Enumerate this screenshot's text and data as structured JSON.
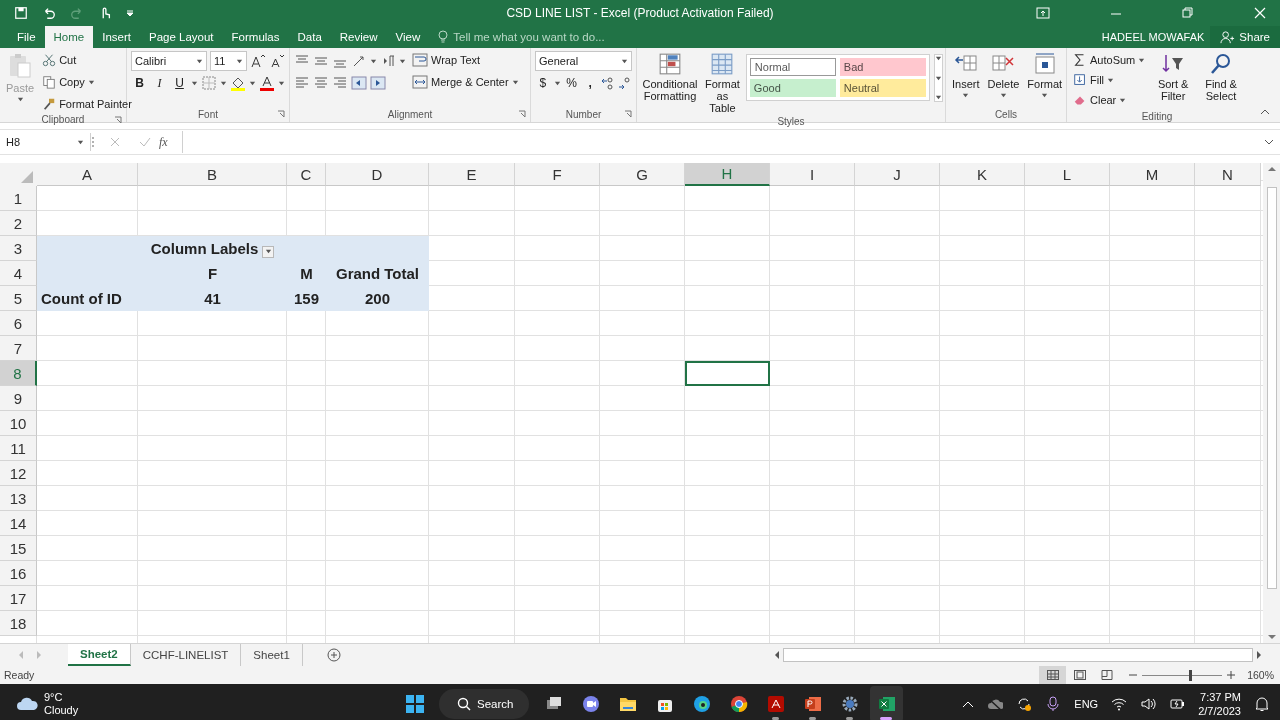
{
  "title_bar": {
    "title": "CSD LINE LIST - Excel (Product Activation Failed)"
  },
  "ribbon_tabs": [
    {
      "label": "File",
      "selected": false
    },
    {
      "label": "Home",
      "selected": true
    },
    {
      "label": "Insert",
      "selected": false
    },
    {
      "label": "Page Layout",
      "selected": false
    },
    {
      "label": "Formulas",
      "selected": false
    },
    {
      "label": "Data",
      "selected": false
    },
    {
      "label": "Review",
      "selected": false
    },
    {
      "label": "View",
      "selected": false
    }
  ],
  "tell_me": {
    "placeholder": "Tell me what you want to do..."
  },
  "account": {
    "user": "HADEEL MOWAFAK",
    "share": "Share"
  },
  "ribbon": {
    "clipboard": {
      "label": "Clipboard",
      "paste": "Paste",
      "cut": "Cut",
      "copy": "Copy",
      "format_painter": "Format Painter"
    },
    "font": {
      "label": "Font",
      "font_name": "Calibri",
      "font_size": "11",
      "bold": "B",
      "italic": "I",
      "underline": "U"
    },
    "alignment": {
      "label": "Alignment",
      "wrap_text": "Wrap Text",
      "merge": "Merge & Center"
    },
    "number": {
      "label": "Number",
      "format": "General",
      "currency": "$",
      "percent": "%",
      "comma": ","
    },
    "styles": {
      "label": "Styles",
      "conditional": "Conditional Formatting",
      "format_table": "Format as Table",
      "cell_styles": [
        {
          "label": "Normal",
          "color": "#ffffff"
        },
        {
          "label": "Bad",
          "color": "#ffc7ce"
        },
        {
          "label": "Good",
          "color": "#c6efce"
        },
        {
          "label": "Neutral",
          "color": "#ffeb9c"
        }
      ]
    },
    "cells": {
      "label": "Cells",
      "insert": "Insert",
      "delete": "Delete",
      "format": "Format"
    },
    "editing": {
      "label": "Editing",
      "autosum": "AutoSum",
      "fill": "Fill",
      "clear": "Clear",
      "sort_filter": "Sort & Filter",
      "find_select": "Find & Select"
    }
  },
  "formula_bar": {
    "name_box": "H8",
    "fx": "fx"
  },
  "sheet": {
    "columns": [
      {
        "label": "A",
        "selected": false
      },
      {
        "label": "B",
        "selected": false
      },
      {
        "label": "C",
        "selected": false
      },
      {
        "label": "D",
        "selected": false
      },
      {
        "label": "E",
        "selected": false
      },
      {
        "label": "F",
        "selected": false
      },
      {
        "label": "G",
        "selected": false
      },
      {
        "label": "H",
        "selected": true
      },
      {
        "label": "I",
        "selected": false
      },
      {
        "label": "J",
        "selected": false
      },
      {
        "label": "K",
        "selected": false
      },
      {
        "label": "L",
        "selected": false
      },
      {
        "label": "M",
        "selected": false
      },
      {
        "label": "N",
        "selected": false
      }
    ],
    "rows": [
      {
        "label": "1",
        "selected": false
      },
      {
        "label": "2",
        "selected": false
      },
      {
        "label": "3",
        "selected": false,
        "cells": [
          {
            "kind": "blank"
          },
          {
            "kind": "header",
            "text": "Column Labels",
            "filter_button": true
          },
          {
            "kind": "blank"
          },
          {
            "kind": "blank"
          }
        ]
      },
      {
        "label": "4",
        "selected": false,
        "cells": [
          {
            "kind": "blank"
          },
          {
            "kind": "value",
            "text": "F"
          },
          {
            "kind": "value",
            "text": "M"
          },
          {
            "kind": "value",
            "text": "Grand Total"
          }
        ]
      },
      {
        "label": "5",
        "selected": false,
        "cells": [
          {
            "kind": "label",
            "text": "Count of ID"
          },
          {
            "kind": "value",
            "text": "41"
          },
          {
            "kind": "value",
            "text": "159"
          },
          {
            "kind": "value",
            "text": "200"
          }
        ]
      },
      {
        "label": "6",
        "selected": false
      },
      {
        "label": "7",
        "selected": false
      },
      {
        "label": "8",
        "selected": true
      },
      {
        "label": "9",
        "selected": false
      },
      {
        "label": "10",
        "selected": false
      },
      {
        "label": "11",
        "selected": false
      },
      {
        "label": "12",
        "selected": false
      },
      {
        "label": "13",
        "selected": false
      },
      {
        "label": "14",
        "selected": false
      },
      {
        "label": "15",
        "selected": false
      },
      {
        "label": "16",
        "selected": false
      },
      {
        "label": "17",
        "selected": false
      },
      {
        "label": "18",
        "selected": false
      }
    ]
  },
  "sheet_tabs": [
    {
      "label": "Sheet2",
      "selected": true
    },
    {
      "label": "CCHF-LINELIST",
      "selected": false
    },
    {
      "label": "Sheet1",
      "selected": false
    }
  ],
  "status_bar": {
    "status": "Ready",
    "views": [
      {
        "kind": "normal",
        "selected": true
      },
      {
        "kind": "page-layout",
        "selected": false
      },
      {
        "kind": "page-break",
        "selected": false
      }
    ],
    "zoom": {
      "level": 0.6,
      "reading": "160%"
    }
  },
  "taskbar": {
    "weather": {
      "temperature": "9°C",
      "condition": "Cloudy"
    },
    "search": "Search",
    "apps": [
      {
        "kind": "task-view",
        "running": false,
        "active": false
      },
      {
        "kind": "chat",
        "running": false,
        "active": false
      },
      {
        "kind": "folder",
        "running": false,
        "active": false
      },
      {
        "kind": "store",
        "running": false,
        "active": false
      },
      {
        "kind": "edge",
        "running": false,
        "active": false
      },
      {
        "kind": "chrome",
        "running": false,
        "active": false
      },
      {
        "kind": "pdf",
        "running": true,
        "active": false
      },
      {
        "kind": "slides",
        "running": true,
        "active": false
      },
      {
        "kind": "settings",
        "running": true,
        "active": false
      },
      {
        "kind": "spreadsheet",
        "running": true,
        "active": true
      }
    ],
    "language": "ENG",
    "time": "7:37 PM",
    "date": "2/7/2023"
  }
}
